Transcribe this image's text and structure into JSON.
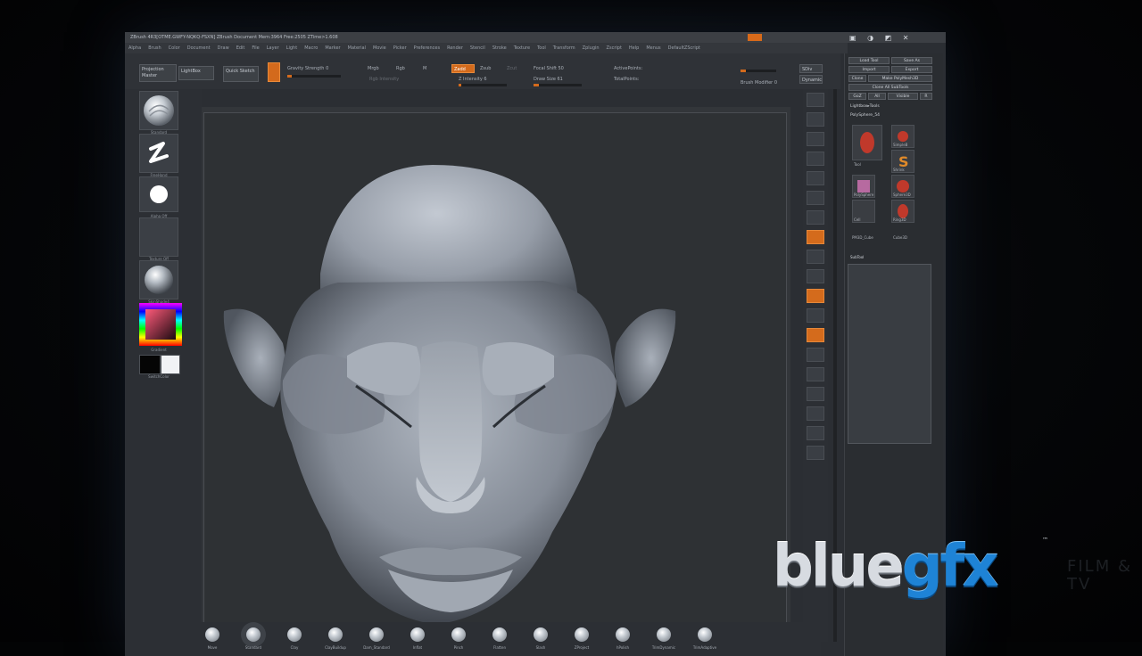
{
  "window": {
    "title": "ZBrush 4R3[OTME.GWFY-NQKQ-FSXN]   ZBrush Document   Mem:3964 Free:2505 ZTime>1.608",
    "title_icons": "▣ ◑ ◩ ✕"
  },
  "menubar": {
    "items": [
      "Alpha",
      "Brush",
      "Color",
      "Document",
      "Draw",
      "Edit",
      "File",
      "Layer",
      "Light",
      "Macro",
      "Marker",
      "Material",
      "Movie",
      "Picker",
      "Preferences",
      "Render",
      "Stencil",
      "Stroke",
      "Texture",
      "Tool",
      "Transform",
      "Zplugin",
      "Zscript",
      "Help",
      "Menus",
      "DefaultZScript"
    ]
  },
  "topshelf": {
    "projection_master": "Projection Master",
    "lightbox": "LightBox",
    "quick_sketch": "Quick Sketch",
    "gravity_strength": "Gravity Strength 0",
    "mrgb": "Mrgb",
    "rgb": "Rgb",
    "m": "M",
    "zadd": "Zadd",
    "zsub": "Zsub",
    "zcut": "Zcut",
    "rgb_intensity": "Rgb Intensity",
    "z_intensity": "Z Intensity 6",
    "focal_shift": "Focal Shift 50",
    "draw_size": "Draw Size 61",
    "dynamic": "Dynamic",
    "sdiv": "SDiv",
    "brush_modifier": "Brush Modifier 0",
    "actpoints": "ActivePoints:",
    "totalpoints": "TotalPoints:"
  },
  "leftshelf": {
    "brush_label": "Standard",
    "stroke_label": "FreeHand",
    "alpha_label": "Alpha Off",
    "texture_label": "Texture Off",
    "material_label": "SkinShade4",
    "color_label": "Gradient",
    "switch_label": "SwitchColor"
  },
  "tray": {
    "buttons": [
      "Load Tool",
      "Save As",
      "Import",
      "Export",
      "Clone",
      "Make PolyMesh3D",
      "Clone All SubTools",
      "GoZ",
      "All",
      "Visible",
      "R"
    ],
    "lightbox_tools": "Lightbox▸Tools",
    "current_tool": "PolySphere_54",
    "thumb_labels": [
      "Tool",
      "SimpleB",
      "CylinderBrush",
      "Shrink",
      "PolySphere",
      "Cylinder3D",
      "Sphere3D",
      "Shadow",
      "Cell",
      "Ring3D",
      "Plane3D",
      "PM3D_Cube",
      "Cube3D"
    ],
    "subtool_label": "SubTool"
  },
  "brushes": {
    "labels": [
      "Move",
      "Standard",
      "Clay",
      "ClayBuildup",
      "Dam_Standard",
      "Inflat",
      "Pinch",
      "Flatten",
      "Slash",
      "ZProject",
      "hPolish",
      "TrimDynamic",
      "TrimAdaptive"
    ]
  },
  "watermark": {
    "blue": "blue",
    "gfx": "gfx",
    "tm": "™",
    "film": "FILM & TV"
  },
  "colors": {
    "accent": "#d36a1c",
    "ui_bg": "#2b2e33",
    "logo_blue": "#1e83d6"
  }
}
